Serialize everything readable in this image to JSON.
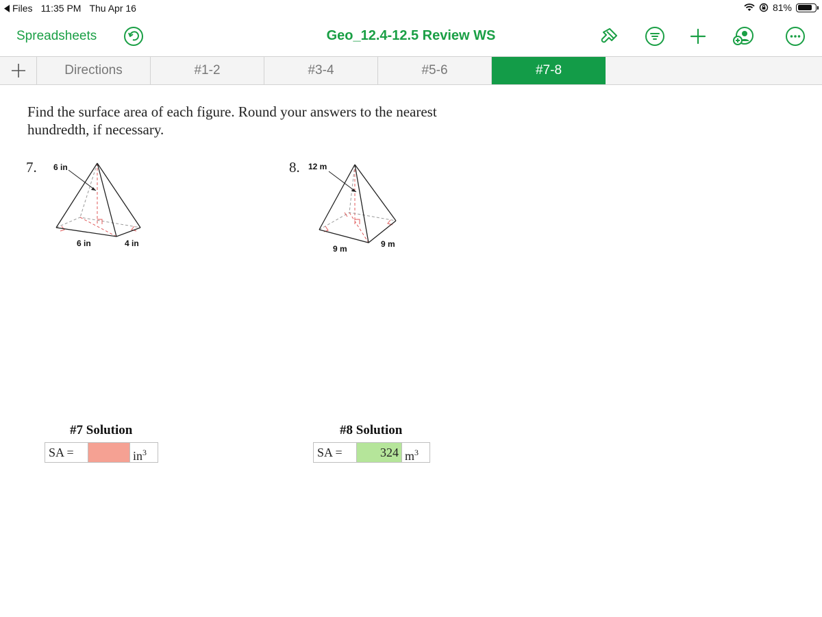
{
  "status_bar": {
    "back_app": "Files",
    "time": "11:35 PM",
    "date": "Thu Apr 16",
    "battery": "81%",
    "battery_level": 0.81
  },
  "toolbar": {
    "back_label": "Spreadsheets",
    "title": "Geo_12.4-12.5 Review WS",
    "accent_color": "#1a9f45",
    "icons": [
      "undo-icon",
      "paintbrush-icon",
      "filter-icon",
      "plus-icon",
      "collaborate-icon",
      "more-icon"
    ]
  },
  "tabs": [
    {
      "label": "Directions"
    },
    {
      "label": "#1-2"
    },
    {
      "label": "#3-4"
    },
    {
      "label": "#5-6"
    },
    {
      "label": "#7-8"
    }
  ],
  "active_tab": "#7-8",
  "sheet": {
    "instructions": "Find the surface area of each figure. Round your answers to the nearest hundredth, if necessary.",
    "problems": [
      {
        "number": "7.",
        "labels": {
          "slant": "6 in",
          "base_front": "6 in",
          "base_side": "4 in"
        },
        "solution_title": "#7 Solution",
        "sa_label": "SA =",
        "answer": "",
        "answer_color": "#f5a193",
        "unit": "in",
        "unit_exp": "3"
      },
      {
        "number": "8.",
        "labels": {
          "slant": "12 m",
          "base_front": "9 m",
          "base_side": "9 m"
        },
        "solution_title": "#8 Solution",
        "sa_label": "SA =",
        "answer": "324",
        "answer_color": "#b5e59a",
        "unit": "m",
        "unit_exp": "3"
      }
    ]
  }
}
